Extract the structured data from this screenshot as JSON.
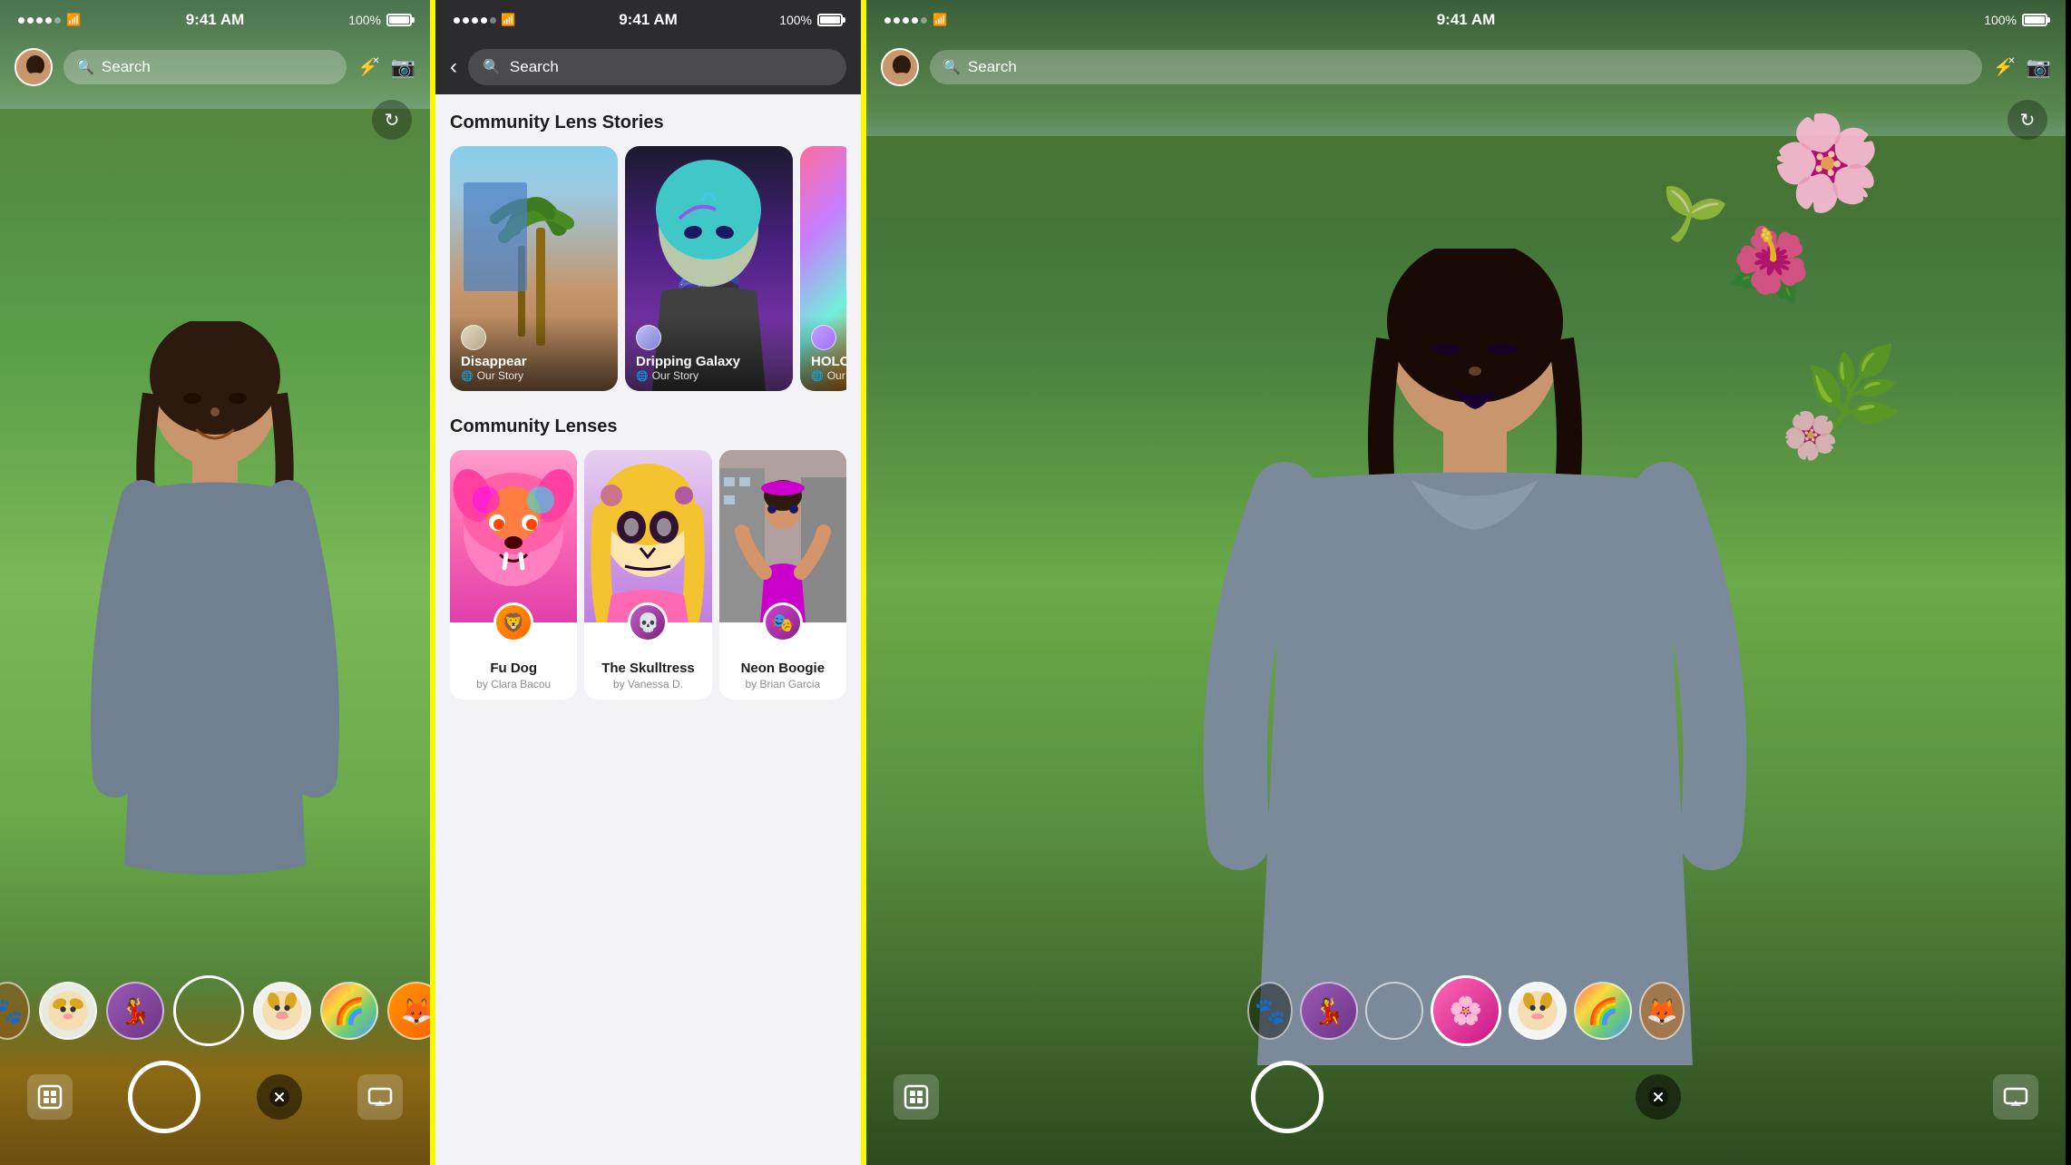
{
  "screens": {
    "left": {
      "status": {
        "time": "9:41 AM",
        "battery": "100%"
      },
      "search": {
        "placeholder": "Search"
      },
      "lenses": [
        {
          "id": "partial-left",
          "emoji": "🐾",
          "partial": true
        },
        {
          "id": "dog-filter",
          "emoji": "🐕"
        },
        {
          "id": "purple-dance",
          "emoji": "💃"
        },
        {
          "id": "plain",
          "emoji": "",
          "active": true
        },
        {
          "id": "dog-snap",
          "emoji": "🐶"
        },
        {
          "id": "rainbow",
          "emoji": "🌈"
        },
        {
          "id": "fox",
          "emoji": "🦊"
        }
      ]
    },
    "middle": {
      "status": {
        "time": "9:41 AM",
        "battery": "100%"
      },
      "search": {
        "placeholder": "Search"
      },
      "sections": {
        "community_lens_stories": {
          "title": "Community Lens Stories",
          "stories": [
            {
              "id": "disappear",
              "name": "Disappear",
              "source": "Our Story",
              "bg_color": "#87ceeb"
            },
            {
              "id": "dripping-galaxy",
              "name": "Dripping Galaxy",
              "source": "Our Story",
              "bg_color": "#6b48a0"
            },
            {
              "id": "holo",
              "name": "HOLO",
              "source": "Our",
              "bg_color": "#ff6b9d"
            }
          ]
        },
        "community_lenses": {
          "title": "Community Lenses",
          "lenses": [
            {
              "id": "fu-dog",
              "name": "Fu Dog",
              "author": "by Clara Bacou",
              "emoji": "🦁"
            },
            {
              "id": "skulltress",
              "name": "The Skulltress",
              "author": "by Vanessa D.",
              "emoji": "💀"
            },
            {
              "id": "neon-boogie",
              "name": "Neon Boogie",
              "author": "by Brian Garcia",
              "emoji": "🎭"
            }
          ]
        }
      }
    },
    "right": {
      "status": {
        "time": "9:41 AM",
        "battery": "100%"
      },
      "search": {
        "placeholder": "Search"
      },
      "lenses": [
        {
          "id": "partial-left-r",
          "emoji": "🐾",
          "partial": true
        },
        {
          "id": "purple-dance-r",
          "emoji": "💃"
        },
        {
          "id": "plain-r",
          "emoji": ""
        },
        {
          "id": "flower-active",
          "emoji": "🌸",
          "active": true
        },
        {
          "id": "dog-snap-r",
          "emoji": "🐶"
        },
        {
          "id": "rainbow-r",
          "emoji": "🌈"
        },
        {
          "id": "more-r",
          "emoji": "🦊",
          "partial": true
        }
      ]
    }
  },
  "icons": {
    "search": "🔍",
    "back_arrow": "‹",
    "flash_x": "⚡",
    "rotate_lens": "↻",
    "globe": "🌐",
    "camera_flip": "📷"
  },
  "colors": {
    "snapchat_yellow": "#FFFC00",
    "dark_bg": "#2c2c2e",
    "light_bg": "#f2f2f7",
    "white": "#ffffff",
    "text_primary": "#1c1c1e",
    "text_secondary": "#8e8e93"
  }
}
